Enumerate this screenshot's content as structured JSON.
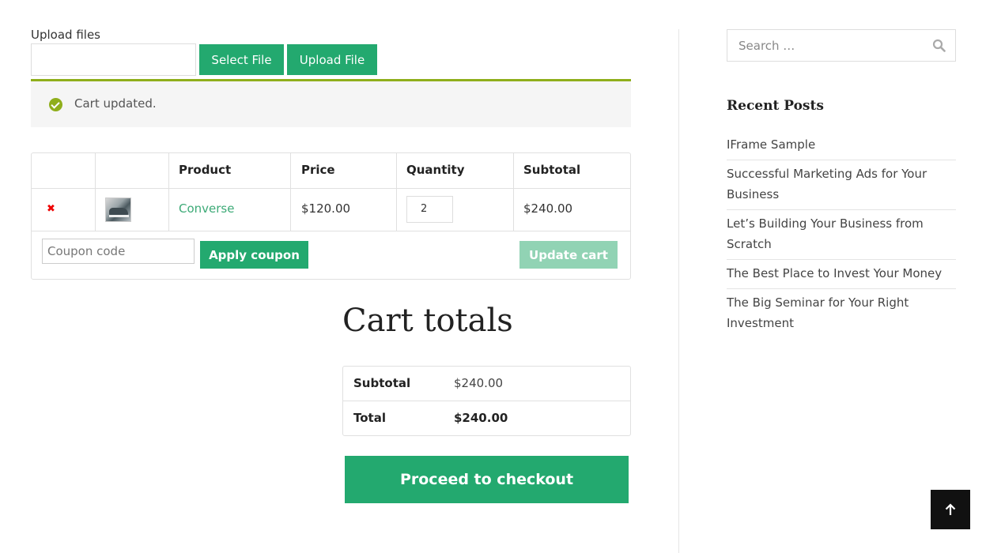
{
  "upload": {
    "label": "Upload files",
    "select_label": "Select File",
    "upload_label": "Upload File"
  },
  "notice": {
    "message": "Cart updated."
  },
  "cart": {
    "columns": [
      "",
      "",
      "Product",
      "Price",
      "Quantity",
      "Subtotal"
    ],
    "rows": [
      {
        "remove": "✖",
        "product": "Converse",
        "price": "$120.00",
        "quantity": "2",
        "subtotal": "$240.00"
      }
    ],
    "coupon_placeholder": "Coupon code",
    "apply_label": "Apply coupon",
    "update_label": "Update cart"
  },
  "totals": {
    "title": "Cart totals",
    "subtotal_label": "Subtotal",
    "subtotal_value": "$240.00",
    "total_label": "Total",
    "total_value": "$240.00",
    "checkout_label": "Proceed to checkout"
  },
  "sidebar": {
    "search_placeholder": "Search …",
    "recent_title": "Recent Posts",
    "posts": [
      "IFrame Sample",
      "Successful Marketing Ads for Your Business",
      "Let’s Building Your Business from Scratch",
      "The Best Place to Invest Your Money",
      "The Big Seminar for Your Right Investment"
    ]
  },
  "colors": {
    "accent": "#23a96f",
    "notice_border": "#8fae1b",
    "link": "#3daa77",
    "remove": "#e00000"
  },
  "icons": {
    "search": "search-icon",
    "back_to_top": "arrow-up-icon",
    "notice": "check-circle-icon"
  }
}
